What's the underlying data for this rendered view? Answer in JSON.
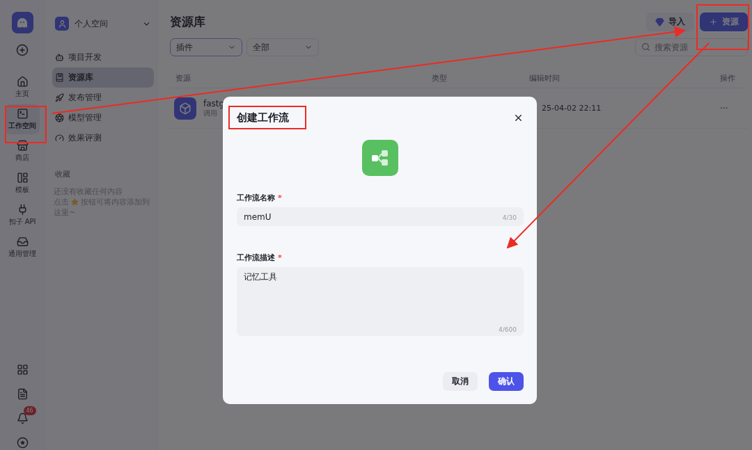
{
  "rail": {
    "items": [
      {
        "label": "主页",
        "selected": false
      },
      {
        "label": "工作空间",
        "selected": true
      },
      {
        "label": "商店",
        "selected": false
      },
      {
        "label": "模板",
        "selected": false
      },
      {
        "label": "扣子 API",
        "selected": false
      },
      {
        "label": "通用管理",
        "selected": false
      }
    ],
    "notification_count": "46"
  },
  "workspace": {
    "name": "个人空间",
    "items": [
      {
        "label": "项目开发",
        "selected": false
      },
      {
        "label": "资源库",
        "selected": true
      },
      {
        "label": "发布管理",
        "selected": false
      },
      {
        "label": "模型管理",
        "selected": false
      },
      {
        "label": "效果评测",
        "selected": false
      }
    ],
    "favorites": {
      "title": "收藏",
      "empty_line": "还没有收藏任何内容",
      "hint_before": "点击",
      "hint_after": "按钮可将内容添加到",
      "hint_end": "这里~"
    }
  },
  "main": {
    "title": "资源库",
    "import_button": "导入",
    "add_button": "资源",
    "filters": [
      {
        "value": "插件",
        "focused": true
      },
      {
        "value": "全部",
        "focused": false
      }
    ],
    "search": {
      "placeholder": "搜索资源"
    },
    "table": {
      "columns": [
        "资源",
        "类型",
        "编辑时间",
        "操作"
      ],
      "rows": [
        {
          "name": "fastg",
          "subtitle": "调用",
          "edited": "25-04-02 22:11",
          "actions": "···"
        }
      ]
    }
  },
  "dialog": {
    "title": "创建工作流",
    "fields": [
      {
        "kind": "input",
        "label": "工作流名称",
        "required_mark": "*",
        "value": "memU",
        "count": "4/30"
      },
      {
        "kind": "textarea",
        "label": "工作流描述",
        "required_mark": "*",
        "value": "记忆工具",
        "count": "4/600"
      }
    ],
    "cancel": "取消",
    "confirm": "确认"
  }
}
